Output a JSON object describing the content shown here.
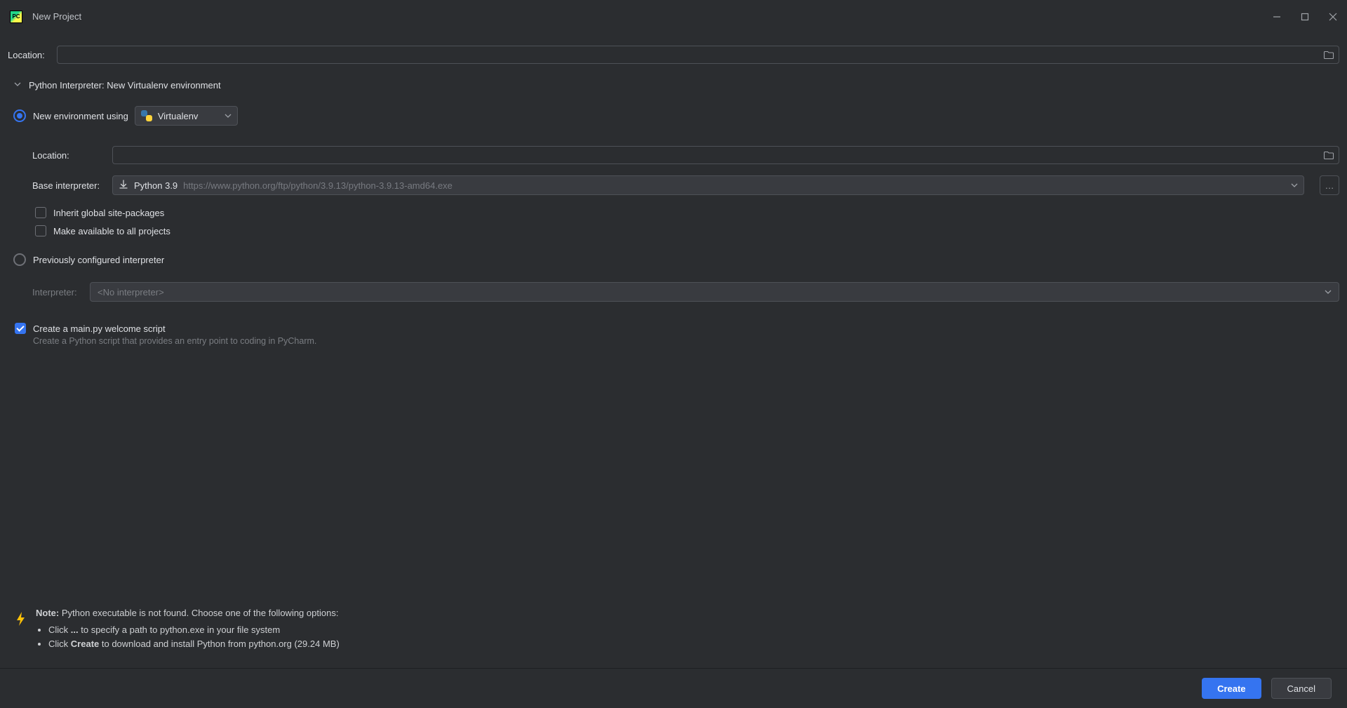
{
  "titlebar": {
    "title": "New Project"
  },
  "location": {
    "label": "Location:",
    "value": ""
  },
  "interpreter_section": {
    "title": "Python Interpreter: New Virtualenv environment",
    "new_env": {
      "radio_label": "New environment using",
      "tool": "Virtualenv",
      "location_label": "Location:",
      "location_value": "",
      "base_label": "Base interpreter:",
      "base_name": "Python 3.9",
      "base_hint": "https://www.python.org/ftp/python/3.9.13/python-3.9.13-amd64.exe",
      "inherit_label": "Inherit global site-packages",
      "make_available_label": "Make available to all projects"
    },
    "prev": {
      "radio_label": "Previously configured interpreter",
      "interpreter_label": "Interpreter:",
      "interpreter_value": "<No interpreter>"
    }
  },
  "welcome": {
    "label": "Create a main.py welcome script",
    "desc": "Create a Python script that provides an entry point to coding in PyCharm."
  },
  "note": {
    "head_strong": "Note:",
    "head_rest": " Python executable is not found. Choose one of the following options:",
    "b1_pre": "Click ",
    "b1_strong": "...",
    "b1_post": " to specify a path to python.exe in your file system",
    "b2_pre": "Click ",
    "b2_strong": "Create",
    "b2_post": " to download and install Python from python.org (29.24 MB)"
  },
  "footer": {
    "create": "Create",
    "cancel": "Cancel"
  }
}
